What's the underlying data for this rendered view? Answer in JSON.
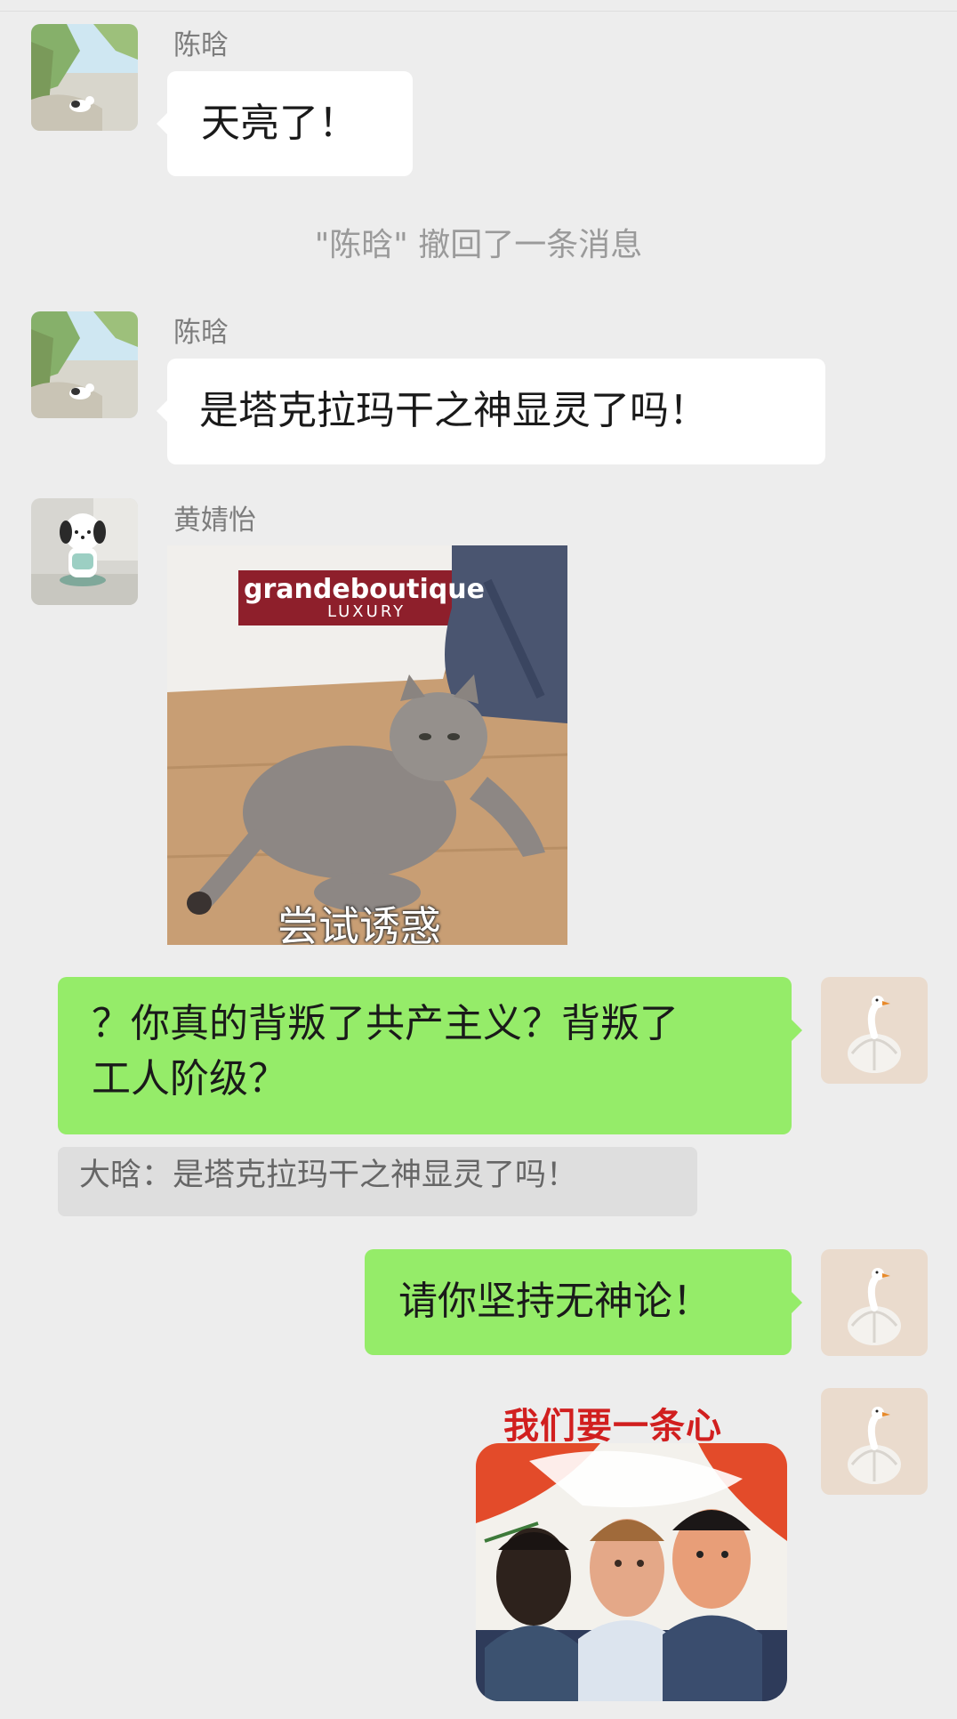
{
  "chat": {
    "messages": [
      {
        "sender": "陈晗",
        "text": "天亮了！"
      },
      {
        "system_notice": "\"陈晗\" 撤回了一条消息"
      },
      {
        "sender": "陈晗",
        "text": "是塔克拉玛干之神显灵了吗！"
      },
      {
        "sender": "黄婧怡",
        "image_caption": "尝试诱惑",
        "bag_brand": "grandeboutique",
        "bag_sub": "LUXURY"
      },
      {
        "self": true,
        "text_line1": "？你真的背叛了共产主义？背叛了",
        "text_line2": "工人阶级？",
        "quote": "大晗：是塔克拉玛干之神显灵了吗！"
      },
      {
        "self": true,
        "text": "请你坚持无神论！"
      },
      {
        "self": true,
        "poster_title": "我们要一条心"
      }
    ]
  },
  "colors": {
    "background": "#ededed",
    "incoming_bubble": "#ffffff",
    "outgoing_bubble": "#95ec69",
    "quote_bg": "#dedede",
    "poster_red": "#d11f1f"
  },
  "icons": {
    "avatar_chen": "landscape-cat-avatar",
    "avatar_huang": "pochacco-figure-avatar",
    "avatar_self": "garlic-swan-avatar"
  }
}
